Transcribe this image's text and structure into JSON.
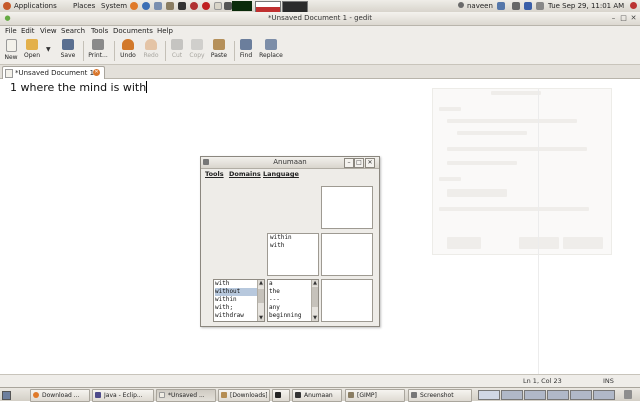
{
  "top_panel": {
    "applications": "Applications",
    "places": "Places",
    "system": "System",
    "user": "naveen",
    "clock": "Tue Sep 29, 11:01 AM"
  },
  "window": {
    "title": "*Unsaved Document 1 - gedit"
  },
  "menubar": {
    "items": [
      "File",
      "Edit",
      "View",
      "Search",
      "Tools",
      "Documents",
      "Help"
    ]
  },
  "toolbar": {
    "new": "New",
    "open": "Open",
    "save": "Save",
    "print": "Print...",
    "undo": "Undo",
    "redo": "Redo",
    "cut": "Cut",
    "copy": "Copy",
    "paste": "Paste",
    "find": "Find",
    "replace": "Replace"
  },
  "tab": {
    "label": "*Unsaved Document 1"
  },
  "editor": {
    "text": "1 where the mind is with"
  },
  "statusbar": {
    "position": "Ln 1, Col 23",
    "mode": "INS"
  },
  "anumaan": {
    "title": "Anumaan",
    "menu": [
      "Tools",
      "Domains",
      "Language"
    ],
    "middle_box": [
      "within",
      "with"
    ],
    "list_left": [
      "with",
      "without",
      "within",
      "with;",
      "withdraw"
    ],
    "list_left_selected": 1,
    "list_right": [
      "a",
      "the",
      "---",
      "any",
      "beginning"
    ]
  },
  "taskbar": {
    "items": [
      "Download ...",
      "Java - Eclip...",
      "*Unsaved ...",
      "[Downloads]",
      "",
      "Anumaan",
      "[GIMP]",
      "Screenshot"
    ]
  },
  "colors": {
    "selection": "#b7c8dd",
    "panel": "#efede9"
  }
}
